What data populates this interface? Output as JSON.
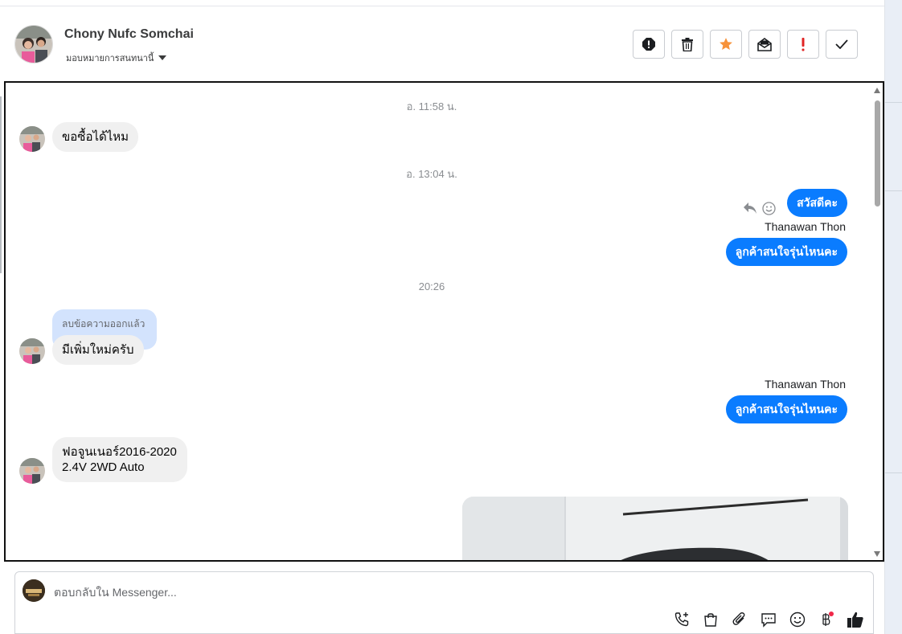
{
  "header": {
    "contact_name": "Chony Nufc Somchai",
    "assign_label": "มอบหมายการสนทนานี้",
    "actions": [
      {
        "name": "report-button",
        "icon": "exclamation-circle-icon"
      },
      {
        "name": "delete-button",
        "icon": "trash-icon"
      },
      {
        "name": "star-button",
        "icon": "star-icon",
        "color": "#f7923a"
      },
      {
        "name": "mark-unread-button",
        "icon": "envelope-icon"
      },
      {
        "name": "important-button",
        "icon": "exclamation-icon",
        "color": "#e02424"
      },
      {
        "name": "done-button",
        "icon": "check-icon"
      }
    ]
  },
  "chat": {
    "ts1": "อ. 11:58 น.",
    "msg1": "ขอซื้อได้ไหม",
    "ts2": "อ. 13:04 น.",
    "out1": "สวัสดีคะ",
    "sender1": "Thanawan Thon",
    "out2": "ลูกค้าสนใจรุ่นไหนคะ",
    "ts3": "20:26",
    "deleted_note": "ลบข้อความออกแล้ว",
    "msg2": "มีเพิ่มใหม่ครับ",
    "sender2": "Thanawan Thon",
    "out3": "ลูกค้าสนใจรุ่นไหนคะ",
    "msg3_line1": "ฟอจูนเนอร์2016-2020",
    "msg3_line2": "2.4V 2WD Auto"
  },
  "composer": {
    "placeholder": "ตอบกลับใน Messenger...",
    "icons": [
      "phone-plus-icon",
      "shopping-bag-icon",
      "paperclip-icon",
      "chat-bubble-icon",
      "emoji-icon",
      "baht-icon",
      "thumbs-up-icon"
    ],
    "badge_color": "#f02849"
  },
  "colors": {
    "outgoing_bubble": "#0a7cff",
    "incoming_bubble": "#f0f0f0",
    "deleted_bubble": "#d3e3fd"
  }
}
